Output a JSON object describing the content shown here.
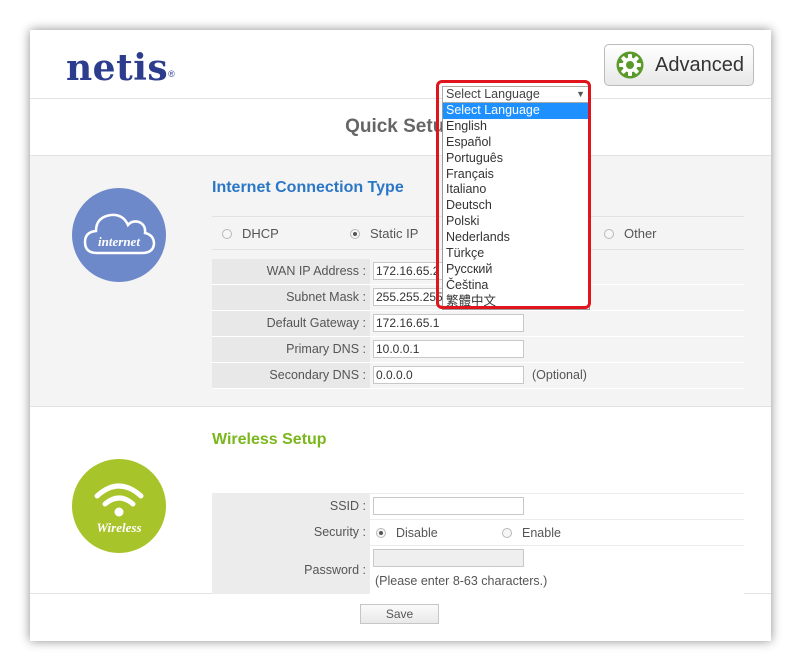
{
  "header": {
    "logo_text": "netis",
    "logo_mark": "®",
    "advanced_label": "Advanced"
  },
  "page_title": "Quick Setup",
  "language": {
    "selected": "Select Language",
    "options": [
      "Select Language",
      "English",
      "Español",
      "Português",
      "Français",
      "Italiano",
      "Deutsch",
      "Polski",
      "Nederlands",
      "Türkçe",
      "Русский",
      "Čeština",
      "繁體中文"
    ]
  },
  "internet": {
    "icon_label": "internet",
    "heading": "Internet Connection Type",
    "connection_types": [
      {
        "label": "DHCP",
        "checked": false
      },
      {
        "label": "Static IP",
        "checked": true
      },
      {
        "label": "Other",
        "checked": false
      }
    ],
    "fields": [
      {
        "label": "WAN IP Address :",
        "value": "172.16.65.2"
      },
      {
        "label": "Subnet Mask :",
        "value": "255.255.255.0"
      },
      {
        "label": "Default Gateway :",
        "value": "172.16.65.1"
      },
      {
        "label": "Primary DNS :",
        "value": "10.0.0.1"
      },
      {
        "label": "Secondary DNS :",
        "value": "0.0.0.0",
        "hint": "(Optional)"
      }
    ]
  },
  "wireless": {
    "icon_label": "Wireless",
    "heading": "Wireless Setup",
    "ssid_label": "SSID :",
    "ssid_value": "",
    "security_label": "Security :",
    "security_options": [
      {
        "label": "Disable",
        "checked": true
      },
      {
        "label": "Enable",
        "checked": false
      }
    ],
    "password_label": "Password :",
    "password_value": "",
    "password_hint": "(Please enter 8-63 characters.)"
  },
  "footer": {
    "save_label": "Save"
  },
  "colors": {
    "logo": "#2b3d8c",
    "internet_icon": "#6d89c9",
    "wireless_icon": "#a7c42a",
    "internet_heading": "#2b77c6",
    "wireless_heading": "#7ab71c",
    "highlight": "#e0141c",
    "list_selected": "#1e90ff"
  }
}
